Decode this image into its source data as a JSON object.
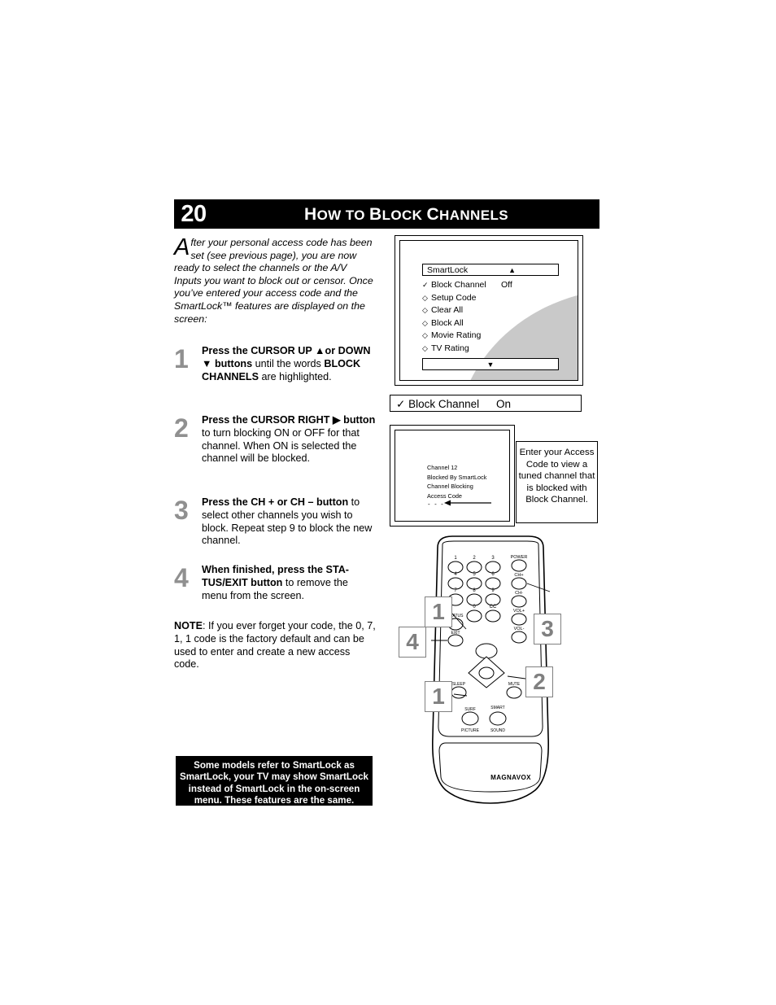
{
  "page": {
    "number": "20",
    "title_first_letters": "H",
    "title": "HOW TO BLOCK CHANNELS",
    "title_parts": [
      "H",
      "OW TO ",
      "B",
      "LOCK ",
      "C",
      "HANNELS"
    ]
  },
  "intro": {
    "dropcap": "A",
    "text": "fter your personal access code has been set (see previous page), you are now ready to select the channels or the A/V Inputs you want to block out or censor. Once you’ve entered your access code and the SmartLock™ features are displayed on the screen:"
  },
  "steps": [
    {
      "number": "1",
      "html": "<b>Press the CURSOR UP ▲or DOWN ▼ buttons</b> until the words <b>BLOCK CHANNELS</b> are highlighted."
    },
    {
      "number": "2",
      "html": "<b>Press the CURSOR RIGHT ▶ button</b> to turn blocking ON or OFF for that channel. When ON is selected the channel will be blocked."
    },
    {
      "number": "3",
      "html": "<b>Press the CH + or CH – button</b> to select other channels you wish to block. Repeat step 9 to block the new channel."
    },
    {
      "number": "4",
      "html": "<b>When finished, press the STA-TUS/EXIT button</b> to remove the menu from the screen."
    }
  ],
  "note": {
    "label": "NOTE",
    "html": "<b>NOTE</b>: If you ever forget your code, the 0, 7, 1, 1 code is the factory default and can be used to enter and create a new access code."
  },
  "models_note": {
    "text": "Some models refer to SmartLock as SmartLock, your TV may show SmartLock instead of SmartLock in the on-screen menu. These features are the same."
  },
  "osd_menu": {
    "title": "SmartLock",
    "up_arrow": "▲",
    "down_arrow": "▼",
    "items": [
      {
        "bullet": "✓",
        "label": "Block Channel",
        "value": "Off"
      },
      {
        "bullet": "◇",
        "label": "Setup Code",
        "value": ""
      },
      {
        "bullet": "◇",
        "label": "Clear All",
        "value": ""
      },
      {
        "bullet": "◇",
        "label": "Block All",
        "value": ""
      },
      {
        "bullet": "◇",
        "label": "Movie Rating",
        "value": ""
      },
      {
        "bullet": "◇",
        "label": "TV Rating",
        "value": ""
      }
    ]
  },
  "block_channel_bar": {
    "bullet": "✓",
    "label": "Block Channel",
    "value": "On"
  },
  "tv_screen": {
    "lines": [
      "Channel 12",
      "Blocked By SmartLock",
      "Channel Blocking",
      "Access Code"
    ],
    "code_dashes": "- - - -"
  },
  "callout": {
    "text": "Enter your Access Code to view a tuned channel that is blocked with Block Channel."
  },
  "remote": {
    "brand": "MAGNAVOX",
    "callouts": [
      "1",
      "3",
      "2",
      "1",
      "4"
    ],
    "keys": {
      "row1": [
        "1",
        "2",
        "3"
      ],
      "row2": [
        "4",
        "5",
        "6"
      ],
      "row3": [
        "7",
        "8",
        "9"
      ],
      "row4": [
        "0",
        "CC"
      ],
      "power": "POWER",
      "ch_plus": "CH+",
      "ch_minus": "CH-",
      "vol_plus": "VOL+",
      "vol_minus": "VOL-",
      "status": "STATUS",
      "exit": "EXIT",
      "sleep": "SLEEP",
      "mute": "MUTE",
      "surf": "SURF",
      "smart_picture": "SMART PICTURE",
      "smart_sound": "SMART SOUND"
    }
  }
}
